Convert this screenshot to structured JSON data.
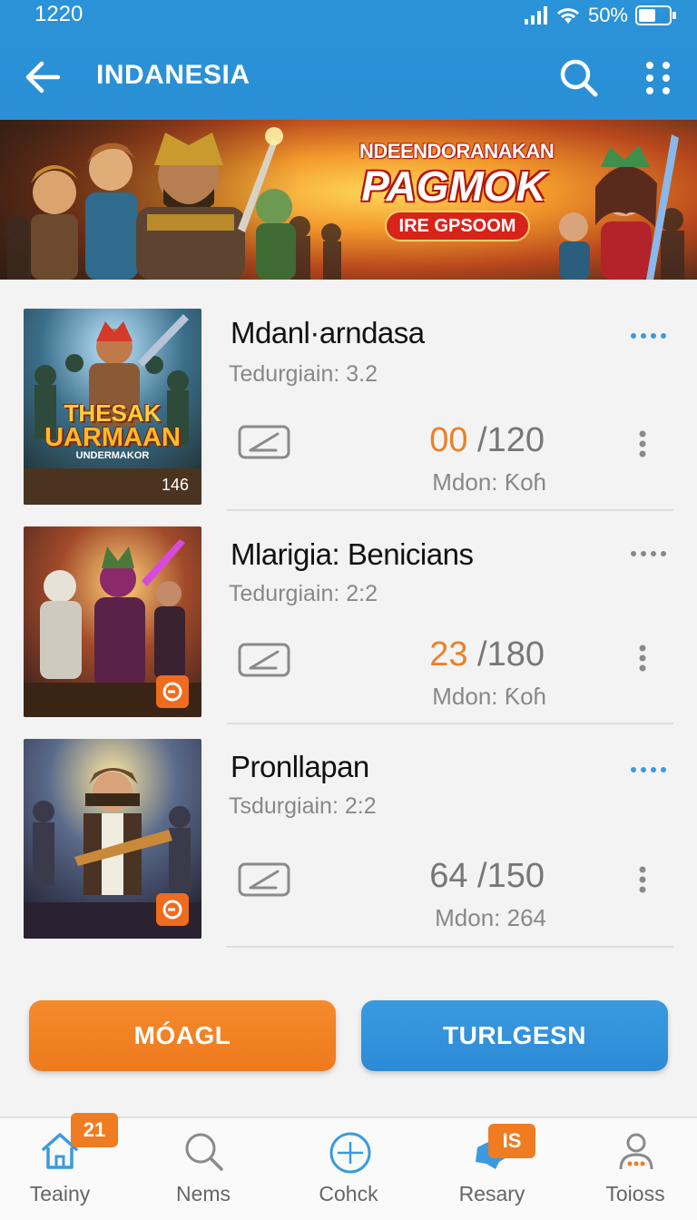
{
  "status_bar": {
    "time": "1220",
    "battery": "50%"
  },
  "app_bar": {
    "title": "INDANESIA"
  },
  "banner": {
    "line1": "NDEENDORANAKAN",
    "line2": "PAGMOK",
    "pill": "IRE GPSOOM"
  },
  "games": [
    {
      "title": "Mdanl·arndasa",
      "subtitle": "Tedurgiain: 3.2",
      "current": "00",
      "total": "/120",
      "meta": "Mdon: Ƙoɦ",
      "thumb_text_1": "THESAK",
      "thumb_text_2": "UARMAAN",
      "thumb_text_3": "UNDERMAKOR",
      "thumb_badge": "146",
      "current_color": "#e98228",
      "dots_color": "#3a9ae0"
    },
    {
      "title": "Mlarigia: Benicians",
      "subtitle": "Tedurgiain: 2:2",
      "current": "23",
      "total": "/180",
      "meta": "Mdon: Ƙoɦ",
      "current_color": "#e98228",
      "dots_color": "#888888"
    },
    {
      "title": "Pronllapan",
      "subtitle": "Tsdurgiain: 2:2",
      "current": "64",
      "total": "/150",
      "meta": "Mdon: 264",
      "current_color": "#777777",
      "dots_color": "#3a9ae0"
    }
  ],
  "actions": {
    "primary": "MÓAGL",
    "secondary": "TURLGESN"
  },
  "bottom_nav": [
    {
      "label": "Teainy",
      "icon": "home-icon",
      "badge": "21"
    },
    {
      "label": "Nems",
      "icon": "search-icon"
    },
    {
      "label": "Cohck",
      "icon": "compass-icon"
    },
    {
      "label": "Resary",
      "icon": "gamepad-icon",
      "badge": "IS"
    },
    {
      "label": "Toioss",
      "icon": "profile-icon"
    }
  ],
  "colors": {
    "primary_blue": "#2a8fd6",
    "accent_orange": "#ee7a1c"
  }
}
